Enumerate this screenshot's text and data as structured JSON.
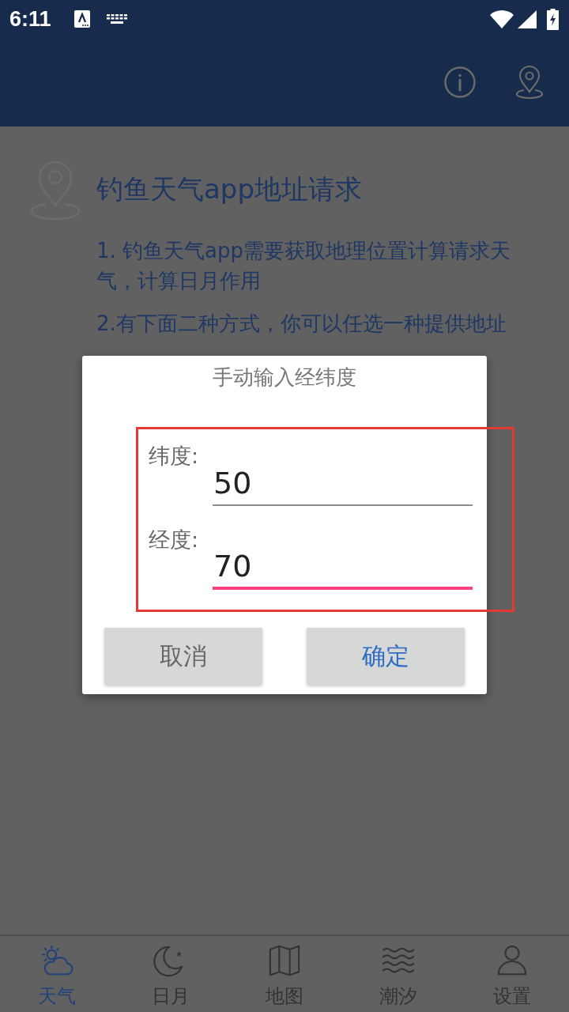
{
  "status_bar": {
    "time": "6:11"
  },
  "page": {
    "title": "钓鱼天气app地址请求",
    "paragraphs": [
      "1. 钓鱼天气app需要获取地理位置计算请求天气，计算日月作用",
      "2.有下面二种方式，你可以任选一种提供地址"
    ]
  },
  "dialog": {
    "title": "手动输入经纬度",
    "fields_highlighted": true,
    "fields": [
      {
        "label": "纬度:",
        "value": "50",
        "focused": false
      },
      {
        "label": "经度:",
        "value": "70",
        "focused": true
      }
    ],
    "buttons": [
      {
        "label": "取消",
        "kind": "cancel"
      },
      {
        "label": "确定",
        "kind": "confirm"
      }
    ]
  },
  "bottom_nav": [
    {
      "label": "天气",
      "selected": true
    },
    {
      "label": "日月",
      "selected": false
    },
    {
      "label": "地图",
      "selected": false
    },
    {
      "label": "潮汐",
      "selected": false
    },
    {
      "label": "设置",
      "selected": false
    }
  ]
}
